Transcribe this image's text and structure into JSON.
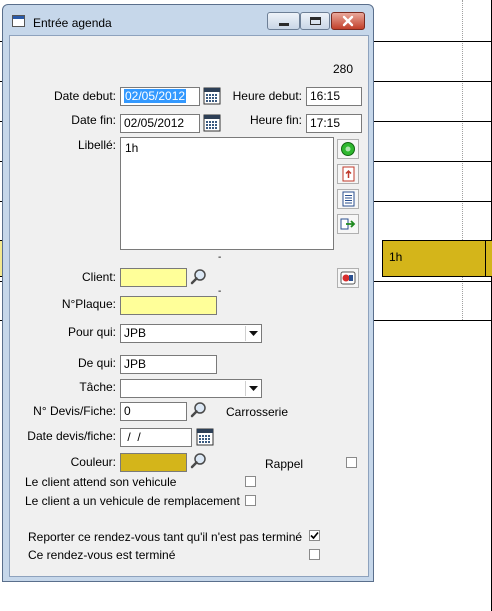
{
  "window": {
    "title": "Entrée agenda",
    "record_number": "280"
  },
  "toolbar": {
    "print_icon": "printer-icon",
    "save_icon": "floppy-disk-icon",
    "delete_icon": "red-x-icon"
  },
  "form": {
    "date_debut": {
      "label": "Date debut:",
      "value": "02/05/2012"
    },
    "heure_debut": {
      "label": "Heure debut:",
      "value": "16:15"
    },
    "date_fin": {
      "label": "Date fin:",
      "value": "02/05/2012"
    },
    "heure_fin": {
      "label": "Heure fin:",
      "value": "17:15"
    },
    "libelle": {
      "label": "Libellé:",
      "value": "1h"
    },
    "client": {
      "label": "Client:",
      "value": ""
    },
    "plaque": {
      "label": "N°Plaque:",
      "value": ""
    },
    "pour_qui": {
      "label": "Pour qui:",
      "value": "JPB"
    },
    "de_qui": {
      "label": "De qui:",
      "value": "JPB"
    },
    "tache": {
      "label": "Tâche:",
      "value": ""
    },
    "devis": {
      "label": "N° Devis/Fiche:",
      "value": "0",
      "extra": "Carrosserie"
    },
    "date_devis": {
      "label": "Date devis/fiche:",
      "value": " /  /"
    },
    "couleur": {
      "label": "Couleur:",
      "color": "#d4b51a"
    },
    "rappel": {
      "label": "Rappel",
      "checked": false
    },
    "attend": {
      "label": "Le client attend son vehicule",
      "checked": false
    },
    "remplacement": {
      "label": "Le client a un vehicule de remplacement",
      "checked": false
    },
    "reporter": {
      "label": "Reporter ce rendez-vous tant qu'il n'est pas terminé",
      "checked": true
    },
    "termine": {
      "label": "Ce rendez-vous est terminé",
      "checked": false
    },
    "dash1": "-",
    "dash2": "-"
  },
  "agenda": {
    "event_label": "1h",
    "event_color": "#d4b51a"
  }
}
